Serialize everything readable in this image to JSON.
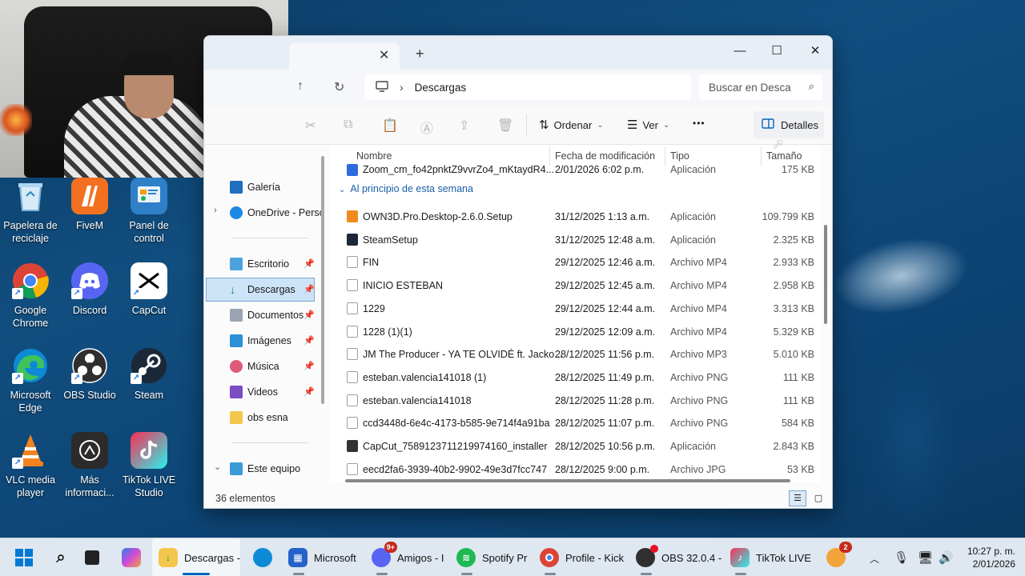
{
  "desktop": {
    "icons": [
      {
        "label": "Papelera de reciclaje",
        "icon": "recycle-bin-icon"
      },
      {
        "label": "FiveM",
        "icon": "fivem-icon"
      },
      {
        "label": "Panel de control",
        "icon": "control-panel-icon"
      },
      {
        "label": "Google Chrome",
        "icon": "chrome-icon"
      },
      {
        "label": "Discord",
        "icon": "discord-icon"
      },
      {
        "label": "CapCut",
        "icon": "capcut-icon"
      },
      {
        "label": "Microsoft Edge",
        "icon": "edge-icon"
      },
      {
        "label": "OBS Studio",
        "icon": "obs-icon"
      },
      {
        "label": "Steam",
        "icon": "steam-icon"
      },
      {
        "label": "VLC media player",
        "icon": "vlc-icon"
      },
      {
        "label": "Más informaci...",
        "icon": "info-icon"
      },
      {
        "label": "TikTok LIVE Studio",
        "icon": "tiktok-live-icon"
      }
    ]
  },
  "explorer": {
    "address": {
      "folder": "Descargas"
    },
    "search": {
      "placeholder": "Buscar en Desca"
    },
    "toolbar": {
      "sort_label": "Ordenar",
      "view_label": "Ver",
      "more_label": "•••",
      "details_label": "Detalles"
    },
    "nav": {
      "items": [
        {
          "label": "Galería",
          "pinned": false
        },
        {
          "label": "OneDrive - Perso",
          "pinned": false
        },
        {
          "label": "Escritorio",
          "pinned": true
        },
        {
          "label": "Descargas",
          "pinned": true
        },
        {
          "label": "Documentos",
          "pinned": true
        },
        {
          "label": "Imágenes",
          "pinned": true
        },
        {
          "label": "Música",
          "pinned": true
        },
        {
          "label": "Videos",
          "pinned": true
        },
        {
          "label": "obs esna",
          "pinned": false
        },
        {
          "label": "Este equipo",
          "pinned": false
        }
      ]
    },
    "columns": {
      "name": "Nombre",
      "modified": "Fecha de modificación",
      "type": "Tipo",
      "size": "Tamaño"
    },
    "partial_row": {
      "name": "Zoom_cm_fo42pnktZ9vvrZo4_mKtaydR4...",
      "modified": "2/01/2026 6:02 p.m.",
      "type": "Aplicación",
      "size": "175 KB"
    },
    "group_label": "Al principio de esta semana",
    "files": [
      {
        "name": "OWN3D.Pro.Desktop-2.6.0.Setup",
        "modified": "31/12/2025 1:13 a.m.",
        "type": "Aplicación",
        "size": "109.799 KB",
        "kind": "app-own3d"
      },
      {
        "name": "SteamSetup",
        "modified": "31/12/2025 12:48 a.m.",
        "type": "Aplicación",
        "size": "2.325 KB",
        "kind": "app-steam"
      },
      {
        "name": "FIN",
        "modified": "29/12/2025 12:46 a.m.",
        "type": "Archivo MP4",
        "size": "2.933 KB",
        "kind": "video"
      },
      {
        "name": "INICIO ESTEBAN",
        "modified": "29/12/2025 12:45 a.m.",
        "type": "Archivo MP4",
        "size": "2.958 KB",
        "kind": "video"
      },
      {
        "name": "1229",
        "modified": "29/12/2025 12:44 a.m.",
        "type": "Archivo MP4",
        "size": "3.313 KB",
        "kind": "video"
      },
      {
        "name": "1228 (1)(1)",
        "modified": "29/12/2025 12:09 a.m.",
        "type": "Archivo MP4",
        "size": "5.329 KB",
        "kind": "video"
      },
      {
        "name": "JM The Producer - YA TE OLVIDÉ ft. Jacko...",
        "modified": "28/12/2025 11:56 p.m.",
        "type": "Archivo MP3",
        "size": "5.010 KB",
        "kind": "audio"
      },
      {
        "name": "esteban.valencia141018 (1)",
        "modified": "28/12/2025 11:49 p.m.",
        "type": "Archivo PNG",
        "size": "111 KB",
        "kind": "image"
      },
      {
        "name": "esteban.valencia141018",
        "modified": "28/12/2025 11:28 p.m.",
        "type": "Archivo PNG",
        "size": "111 KB",
        "kind": "image"
      },
      {
        "name": "ccd3448d-6e4c-4173-b585-9e714f4a91ba",
        "modified": "28/12/2025 11:07 p.m.",
        "type": "Archivo PNG",
        "size": "584 KB",
        "kind": "image"
      },
      {
        "name": "CapCut_7589123711219974160_installer",
        "modified": "28/12/2025 10:56 p.m.",
        "type": "Aplicación",
        "size": "2.843 KB",
        "kind": "app-capcut"
      },
      {
        "name": "eecd2fa6-3939-40b2-9902-49e3d7fcc747",
        "modified": "28/12/2025 9:00 p.m.",
        "type": "Archivo JPG",
        "size": "53 KB",
        "kind": "image"
      }
    ],
    "status": {
      "count": "36 elementos"
    }
  },
  "taskbar": {
    "items": [
      {
        "label": "",
        "icon": "start-icon"
      },
      {
        "label": "",
        "icon": "search-icon"
      },
      {
        "label": "",
        "icon": "task-view-icon"
      },
      {
        "label": "",
        "icon": "m365-icon"
      },
      {
        "label": "Descargas -",
        "icon": "file-explorer-icon"
      },
      {
        "label": "",
        "icon": "edge-icon"
      },
      {
        "label": "Microsoft",
        "icon": "microsoft-store-icon"
      },
      {
        "label": "Amigos - I",
        "icon": "discord-icon",
        "badge": "9+"
      },
      {
        "label": "Spotify Pr",
        "icon": "spotify-icon"
      },
      {
        "label": "Profile - Kick",
        "icon": "chrome-icon"
      },
      {
        "label": "OBS 32.0.4 -",
        "icon": "obs-icon"
      },
      {
        "label": "TikTok LIVE S",
        "icon": "tiktok-live-icon"
      },
      {
        "label": "",
        "icon": "weather-icon",
        "badge": "2"
      }
    ],
    "clock": {
      "time": "10:27 p. m.",
      "date": "2/01/2026"
    }
  },
  "colors": {
    "accent": "#0067c0",
    "selection": "#cde3f7",
    "taskbar": "#dfe7f0"
  }
}
